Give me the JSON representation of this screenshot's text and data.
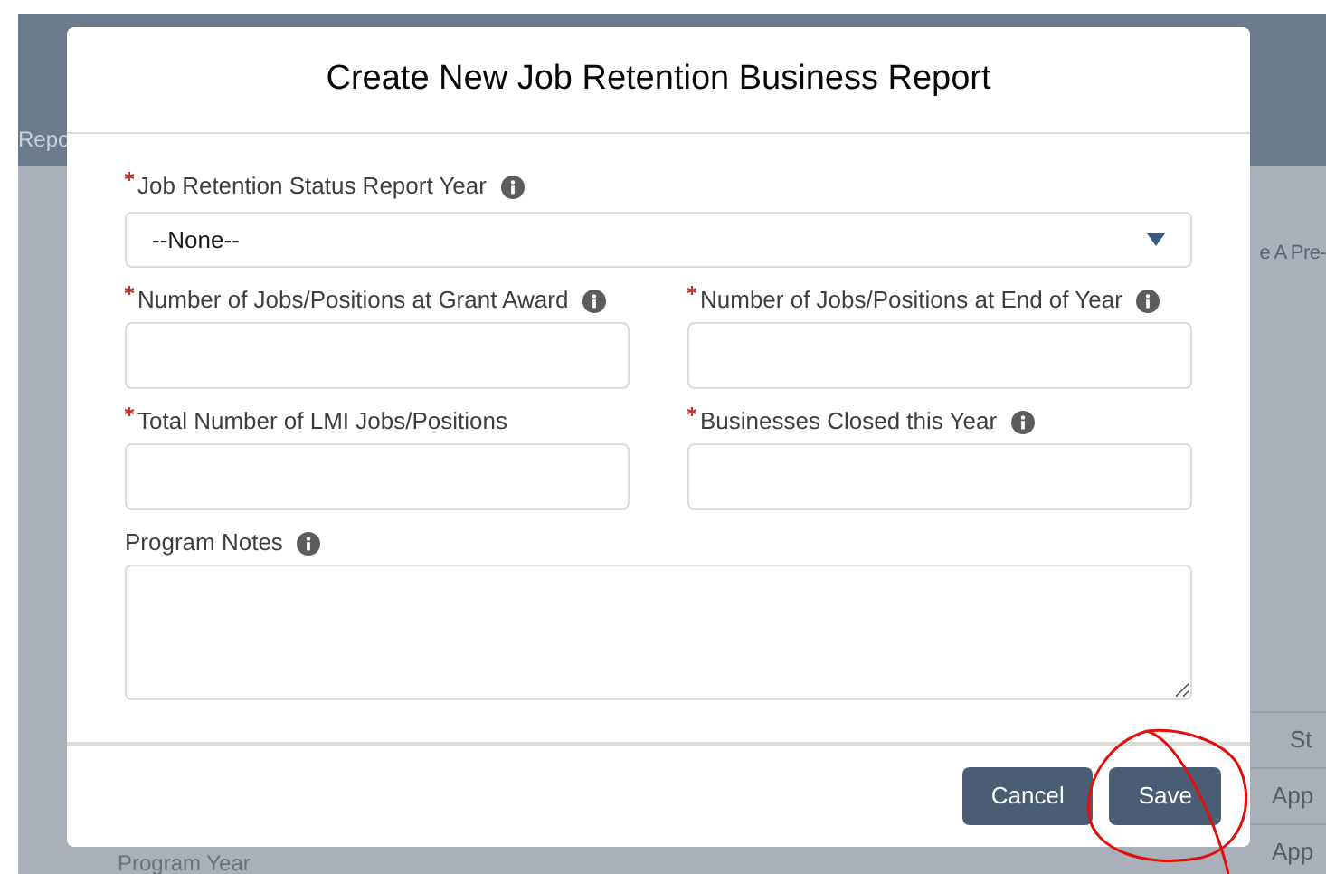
{
  "background": {
    "header_text": "Repo",
    "side_tab": "e A Pre-",
    "table_cells": [
      "St",
      "App",
      "App"
    ],
    "bottom_label": "Program Year"
  },
  "modal": {
    "title": "Create New Job Retention Business Report",
    "fields": [
      {
        "kind": "select",
        "label": "Job Retention Status Report Year",
        "required": true,
        "info": true,
        "value": "--None--"
      },
      {
        "kind": "input",
        "label": "Number of Jobs/Positions at Grant Award",
        "required": true,
        "info": true
      },
      {
        "kind": "input",
        "label": "Number of Jobs/Positions at End of Year",
        "required": true,
        "info": true
      },
      {
        "kind": "input",
        "label": "Total Number of LMI Jobs/Positions",
        "required": true,
        "info": false
      },
      {
        "kind": "input",
        "label": "Businesses Closed this Year",
        "required": true,
        "info": true
      },
      {
        "kind": "textarea",
        "label": "Program Notes",
        "required": false,
        "info": true
      }
    ],
    "buttons": [
      "Cancel",
      "Save"
    ]
  }
}
